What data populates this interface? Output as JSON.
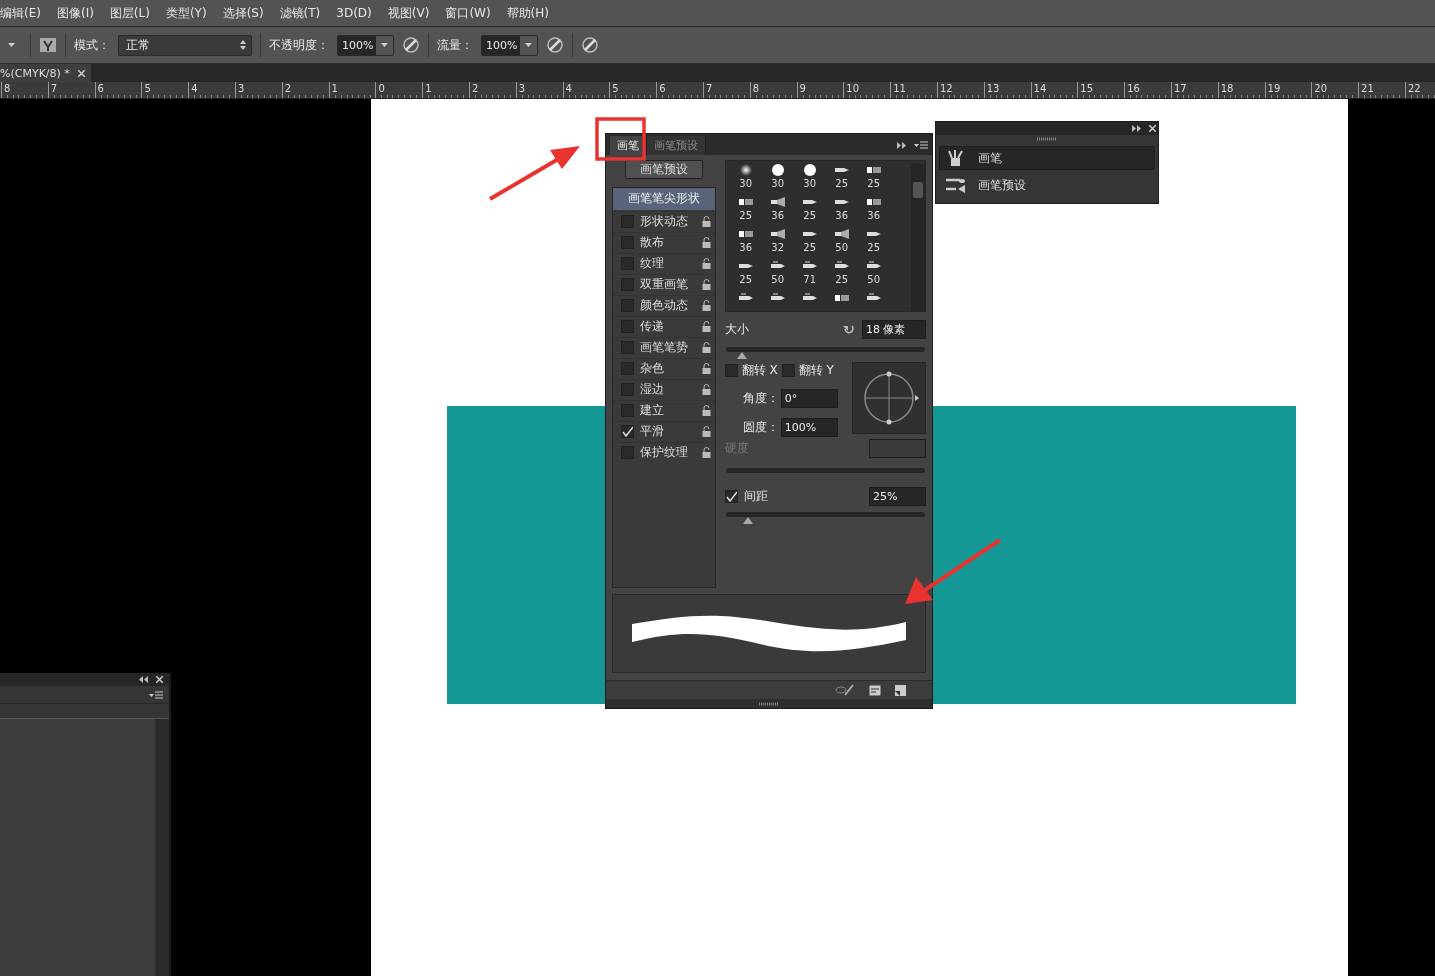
{
  "menu_bar": [
    "编辑(E)",
    "图像(I)",
    "图层(L)",
    "类型(Y)",
    "选择(S)",
    "滤镜(T)",
    "3D(D)",
    "视图(V)",
    "窗口(W)",
    "帮助(H)"
  ],
  "options_bar": {
    "mode_label": "模式：",
    "mode_value": "正常",
    "opacity_label": "不透明度：",
    "opacity_value": "100%",
    "flow_label": "流量：",
    "flow_value": "100%"
  },
  "document_tab": {
    "title": "%(CMYK/8) *"
  },
  "ruler": [
    "8",
    "7",
    "6",
    "5",
    "4",
    "3",
    "2",
    "1",
    "0",
    "1",
    "2",
    "3",
    "4",
    "5",
    "6",
    "7",
    "8",
    "9",
    "10",
    "11",
    "12",
    "13",
    "14",
    "15",
    "16",
    "17",
    "18",
    "19",
    "20",
    "21",
    "22"
  ],
  "brush_panel": {
    "tabs": [
      {
        "label": "画笔",
        "selected": true
      },
      {
        "label": "画笔预设",
        "selected": false
      }
    ],
    "presets_button": "画笔预设",
    "tip_shape": {
      "label": "画笔笔尖形状",
      "selected": true
    },
    "options": [
      {
        "label": "形状动态",
        "checked": false
      },
      {
        "label": "散布",
        "checked": false
      },
      {
        "label": "纹理",
        "checked": false
      },
      {
        "label": "双重画笔",
        "checked": false
      },
      {
        "label": "颜色动态",
        "checked": false
      },
      {
        "label": "传递",
        "checked": false
      },
      {
        "label": "画笔笔势",
        "checked": false
      },
      {
        "label": "杂色",
        "checked": false
      },
      {
        "label": "湿边",
        "checked": false
      },
      {
        "label": "建立",
        "checked": false
      },
      {
        "label": "平滑",
        "checked": true
      },
      {
        "label": "保护纹理",
        "checked": false
      }
    ],
    "tips": [
      {
        "kind": "soft",
        "size": "30"
      },
      {
        "kind": "hard",
        "size": "30"
      },
      {
        "kind": "hard",
        "size": "30"
      },
      {
        "kind": "tip",
        "size": "25"
      },
      {
        "kind": "flat",
        "size": "25"
      },
      {
        "kind": "flat",
        "size": "25"
      },
      {
        "kind": "fan",
        "size": "36"
      },
      {
        "kind": "tip",
        "size": "25"
      },
      {
        "kind": "tip",
        "size": "36"
      },
      {
        "kind": "flat",
        "size": "36"
      },
      {
        "kind": "flat",
        "size": "36"
      },
      {
        "kind": "fan",
        "size": "32"
      },
      {
        "kind": "tip",
        "size": "25"
      },
      {
        "kind": "fan",
        "size": "50"
      },
      {
        "kind": "tip",
        "size": "25"
      },
      {
        "kind": "tip",
        "size": "25"
      },
      {
        "kind": "pencil",
        "size": "50"
      },
      {
        "kind": "pencil",
        "size": "71"
      },
      {
        "kind": "pencil",
        "size": "25"
      },
      {
        "kind": "pencil",
        "size": "50"
      },
      {
        "kind": "pencil"
      },
      {
        "kind": "pencil"
      },
      {
        "kind": "pencil"
      },
      {
        "kind": "flat"
      },
      {
        "kind": "pencil"
      }
    ],
    "size": {
      "label": "大小",
      "value": "18 像素",
      "level": 0.08
    },
    "flip_x": {
      "label": "翻转 X",
      "checked": false
    },
    "flip_y": {
      "label": "翻转 Y",
      "checked": false
    },
    "angle": {
      "label": "角度：",
      "value": "0°"
    },
    "roundness": {
      "label": "圆度：",
      "value": "100%"
    },
    "hardness": {
      "label": "硬度",
      "disabled": true
    },
    "spacing": {
      "label": "间距",
      "checked": true,
      "value": "25%",
      "level": 0.11
    }
  },
  "collapsed_panel": {
    "items": [
      {
        "label": "画笔",
        "kind": "brushes",
        "selected": true
      },
      {
        "label": "画笔预设",
        "kind": "presets",
        "selected": false
      }
    ]
  }
}
